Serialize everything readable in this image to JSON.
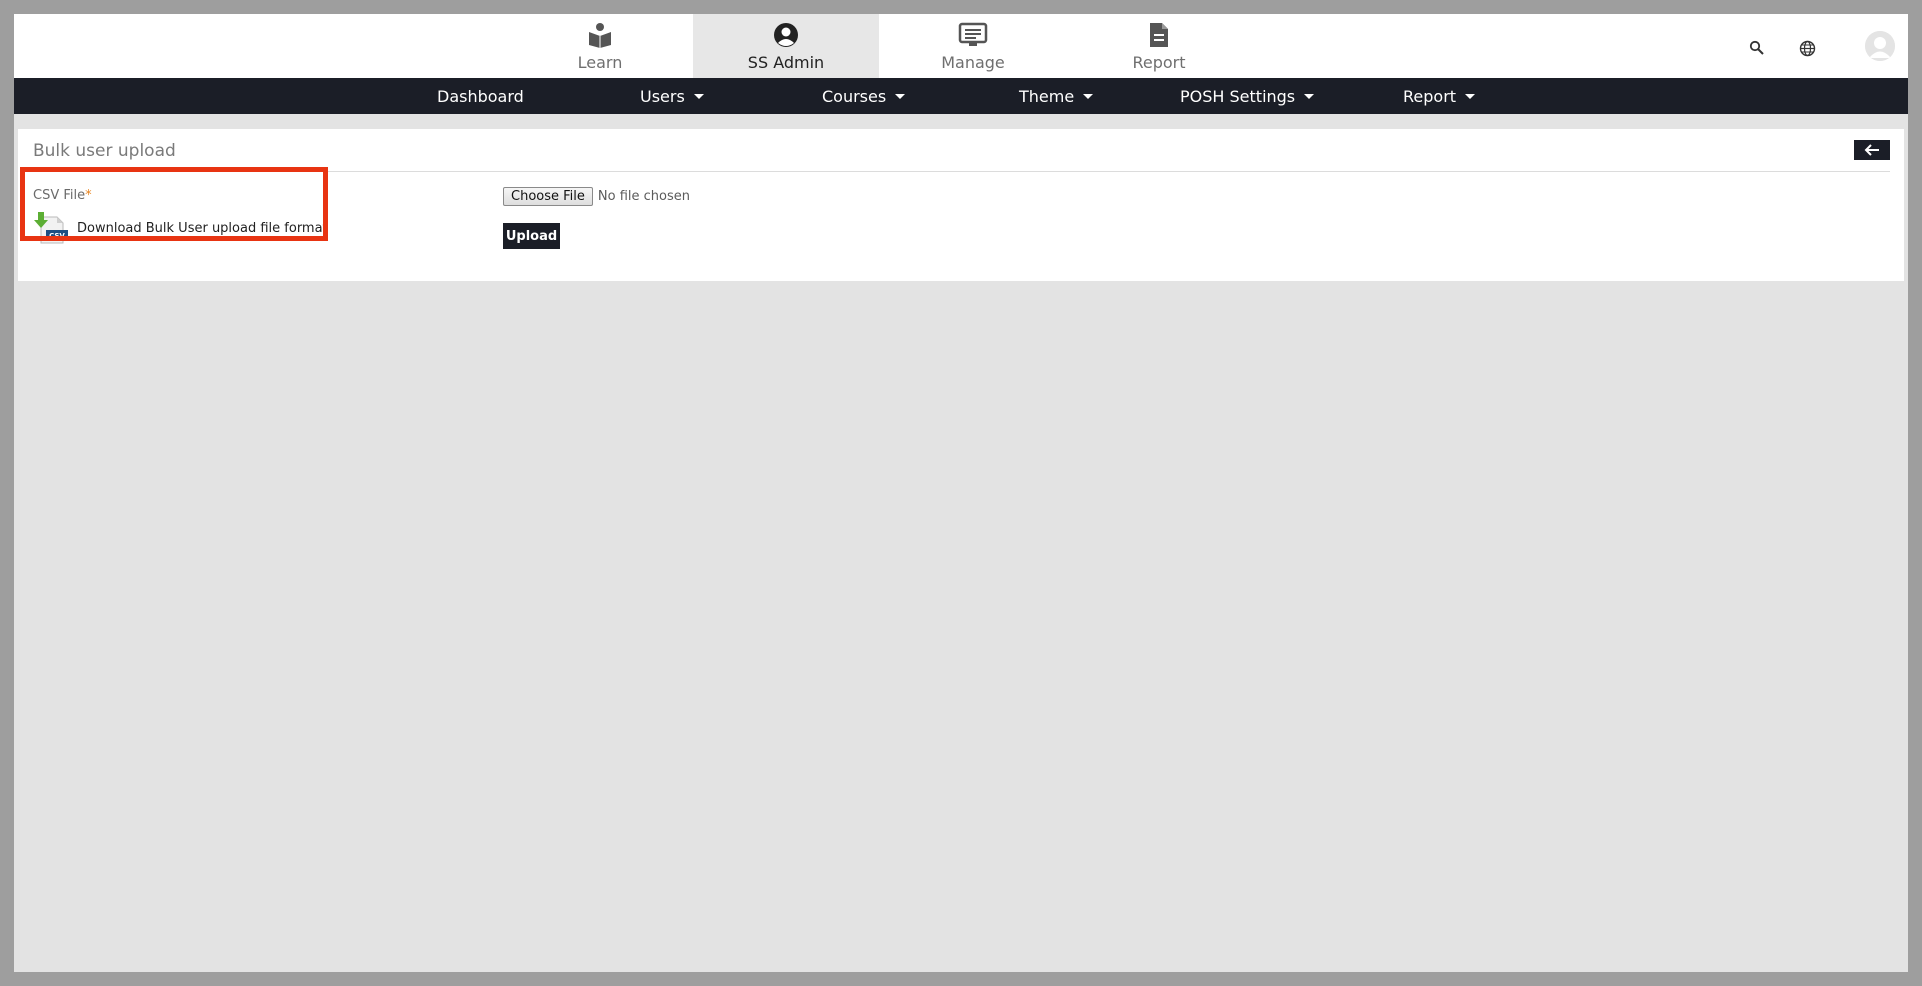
{
  "topnav": {
    "tabs": [
      {
        "label": "Learn",
        "icon": "book-reader-icon",
        "active": false
      },
      {
        "label": "SS Admin",
        "icon": "user-circle-icon",
        "active": true
      },
      {
        "label": "Manage",
        "icon": "monitor-list-icon",
        "active": false
      },
      {
        "label": "Report",
        "icon": "document-icon",
        "active": false
      }
    ],
    "utilities": [
      "search-icon",
      "globe-icon",
      "avatar"
    ]
  },
  "menubar": {
    "items": [
      {
        "label": "Dashboard",
        "dropdown": false
      },
      {
        "label": "Users",
        "dropdown": true
      },
      {
        "label": "Courses",
        "dropdown": true
      },
      {
        "label": "Theme",
        "dropdown": true
      },
      {
        "label": "POSH Settings",
        "dropdown": true
      },
      {
        "label": "Report",
        "dropdown": true
      }
    ]
  },
  "panel": {
    "title": "Bulk user upload",
    "back_icon": "arrow-left-icon",
    "csv_label": "CSV File",
    "required_mark": "*",
    "choose_button": "Choose File",
    "no_file_text": "No file chosen",
    "upload_button": "Upload",
    "download_link_text": "Download Bulk User upload file format",
    "download_icon": "csv-download-icon"
  },
  "colors": {
    "nav_dark": "#1b1e27",
    "highlight": "#e83412",
    "required": "#e8841e",
    "background": "#e3e3e3"
  }
}
